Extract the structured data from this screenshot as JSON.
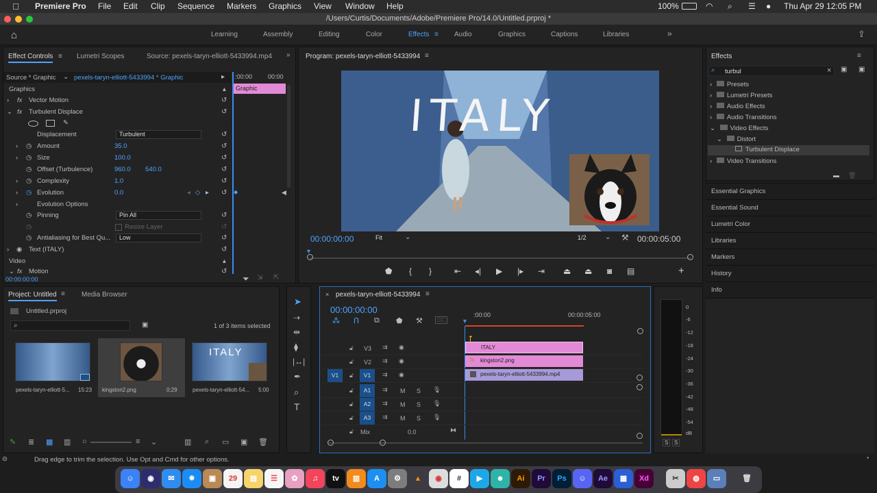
{
  "menubar": {
    "apple": "",
    "app": "Premiere Pro",
    "items": [
      "File",
      "Edit",
      "Clip",
      "Sequence",
      "Markers",
      "Graphics",
      "View",
      "Window",
      "Help"
    ],
    "battery": "100%",
    "datetime": "Thu Apr 29  12:05 PM"
  },
  "window": {
    "title": "/Users/Curtis/Documents/Adobe/Premiere Pro/14.0/Untitled.prproj *"
  },
  "workspaces": {
    "items": [
      "Learning",
      "Assembly",
      "Editing",
      "Color",
      "Effects",
      "Audio",
      "Graphics",
      "Captions",
      "Libraries"
    ],
    "active": "Effects"
  },
  "effect_controls": {
    "tab1": "Effect Controls",
    "tab2": "Lumetri Scopes",
    "tab3": "Source: pexels-taryn-elliott-5433994.mp4",
    "source": "Source * Graphic",
    "clip": "pexels-taryn-elliott-5433994 * Graphic",
    "t0": ":00:00",
    "t1": "00:00",
    "graphic_clip": "Graphic",
    "graphics_header": "Graphics",
    "vector_motion": "Vector Motion",
    "turbulent": "Turbulent Displace",
    "displacement_label": "Displacement",
    "displacement_value": "Turbulent",
    "amount_label": "Amount",
    "amount_value": "35.0",
    "size_label": "Size",
    "size_value": "100.0",
    "offset_label": "Offset (Turbulence)",
    "offset_x": "960.0",
    "offset_y": "540.0",
    "complexity_label": "Complexity",
    "complexity_value": "1.0",
    "evolution_label": "Evolution",
    "evolution_value": "0.0",
    "evolution_options": "Evolution Options",
    "pinning_label": "Pinning",
    "pinning_value": "Pin All",
    "resize_label": "Resize Layer",
    "antialias_label": "Antialiasing for Best Qu...",
    "antialias_value": "Low",
    "text_layer": "Text (ITALY)",
    "video_header": "Video",
    "motion": "Motion",
    "timecode": "00:00:00:00"
  },
  "program": {
    "title": "Program: pexels-taryn-elliott-5433994",
    "overlay_text": "ITALY",
    "timecode": "00:00:00:00",
    "fit": "Fit",
    "quality": "1/2",
    "duration": "00:00:05:00"
  },
  "project": {
    "tab1": "Project: Untitled",
    "tab2": "Media Browser",
    "file": "Untitled.prproj",
    "selected": "1 of 3 items selected",
    "items": [
      {
        "name": "pexels-taryn-elliott-5...",
        "dur": "15:23"
      },
      {
        "name": "kingston2.png",
        "dur": "0;29"
      },
      {
        "name": "pexels-taryn-elliott-54...",
        "dur": "5:00"
      }
    ]
  },
  "timeline": {
    "tab": "pexels-taryn-elliott-5433994",
    "timecode": "00:00:00:00",
    "ruler0": ":00:00",
    "ruler1": "00:00:05:00",
    "tracks": [
      "V3",
      "V2",
      "V1",
      "A1",
      "A2",
      "A3"
    ],
    "source_patch": "V1",
    "mix": "Mix",
    "mix_value": "0.0",
    "clips": [
      {
        "label": "ITALY"
      },
      {
        "label": "kingston2.png"
      },
      {
        "label": "pexels-taryn-elliott-5433994.mp4"
      }
    ]
  },
  "meter": {
    "ticks": [
      "0",
      "-6",
      "-12",
      "-18",
      "-24",
      "-30",
      "-36",
      "-42",
      "-48",
      "-54",
      "dB"
    ],
    "solo": "S"
  },
  "effects_panel": {
    "title": "Effects",
    "search": "turbul",
    "tree": [
      "Presets",
      "Lumetri Presets",
      "Audio Effects",
      "Audio Transitions",
      "Video Effects",
      "Distort",
      "Turbulent Displace",
      "Video Transitions"
    ],
    "panels": [
      "Essential Graphics",
      "Essential Sound",
      "Lumetri Color",
      "Libraries",
      "Markers",
      "History",
      "Info"
    ]
  },
  "status": {
    "text": "Drag edge to trim the selection. Use Opt and Cmd for other options."
  },
  "colors": {
    "accent": "#4fa3ff",
    "graphic_clip": "#e38ad6",
    "video_clip": "#a89ad8",
    "playhead": "#3a8ef0"
  }
}
